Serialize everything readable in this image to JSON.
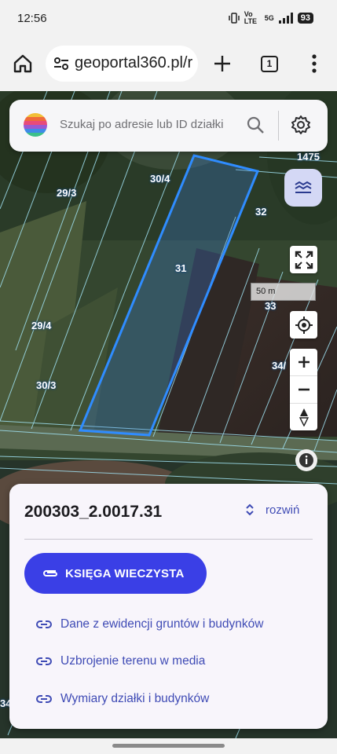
{
  "status_bar": {
    "time": "12:56",
    "network_label": "Vo LTE",
    "signal_label": "5G",
    "battery": "93"
  },
  "browser": {
    "url": "geoportal360.pl/r",
    "tab_count": "1"
  },
  "search": {
    "placeholder": "Szukaj po adresie lub ID działki"
  },
  "map": {
    "plot_labels": [
      "1475",
      "30/4",
      "29/3",
      "32",
      "31",
      "33",
      "29/4",
      "34/",
      "30/3",
      "34"
    ],
    "scale_label": "50 m"
  },
  "panel": {
    "parcel_id": "200303_2.0017.31",
    "expand_label": "rozwiń",
    "kw_button_label": "KSIĘGA WIECZYSTA",
    "links": [
      "Dane z ewidencji gruntów i budynków",
      "Uzbrojenie terenu w media",
      "Wymiary działki i budynków"
    ]
  },
  "colors": {
    "accent": "#3a3fe6",
    "link": "#3f4bb5",
    "parcel_outline": "#2f8cff"
  },
  "icons": [
    "home-icon",
    "tune-icon",
    "plus-icon",
    "tabs-icon",
    "more-vert-icon",
    "rainbow-logo-icon",
    "search-icon",
    "gear-icon",
    "layers-icon",
    "fullscreen-icon",
    "my-location-icon",
    "zoom-in-icon",
    "zoom-out-icon",
    "compass-icon",
    "info-icon",
    "unfold-icon",
    "attach-icon",
    "link-icon"
  ]
}
